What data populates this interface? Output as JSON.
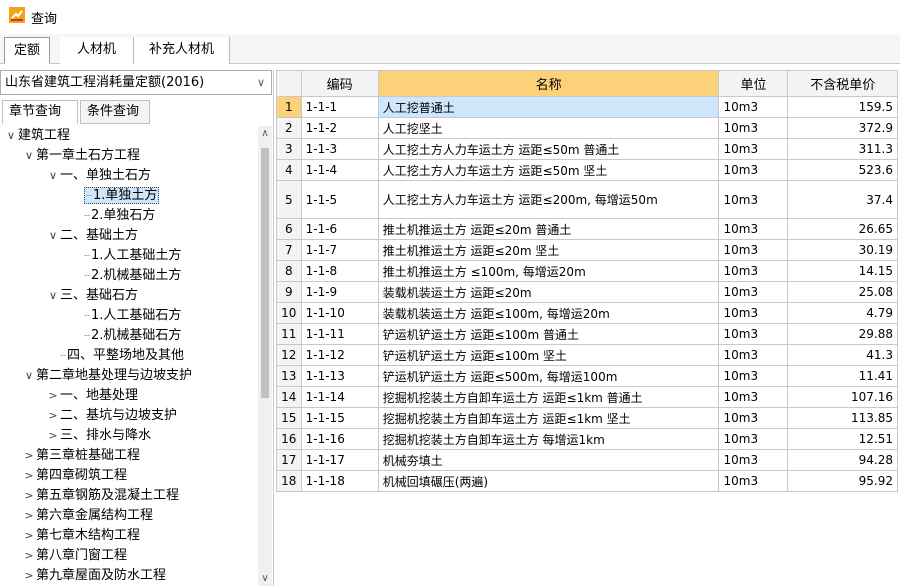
{
  "window": {
    "title": "查询"
  },
  "tabs": [
    "定额",
    "人材机",
    "补充人材机"
  ],
  "left": {
    "quota_select": "山东省建筑工程消耗量定额(2016)",
    "query_tabs": [
      "章节查询",
      "条件查询"
    ],
    "tree": [
      {
        "label": "建筑工程",
        "level": 0,
        "toggle": "∨"
      },
      {
        "label": "第一章土石方工程",
        "level": 1,
        "toggle": "∨"
      },
      {
        "label": "一、单独土石方",
        "level": 2,
        "toggle": "∨"
      },
      {
        "label": "1.单独土方",
        "level": 3,
        "toggle": "",
        "selected": true
      },
      {
        "label": "2.单独石方",
        "level": 3,
        "toggle": ""
      },
      {
        "label": "二、基础土方",
        "level": 2,
        "toggle": "∨"
      },
      {
        "label": "1.人工基础土方",
        "level": 3,
        "toggle": ""
      },
      {
        "label": "2.机械基础土方",
        "level": 3,
        "toggle": ""
      },
      {
        "label": "三、基础石方",
        "level": 2,
        "toggle": "∨"
      },
      {
        "label": "1.人工基础石方",
        "level": 3,
        "toggle": ""
      },
      {
        "label": "2.机械基础石方",
        "level": 3,
        "toggle": ""
      },
      {
        "label": "四、平整场地及其他",
        "level": 2,
        "toggle": ""
      },
      {
        "label": "第二章地基处理与边坡支护",
        "level": 1,
        "toggle": "∨"
      },
      {
        "label": "一、地基处理",
        "level": 2,
        "toggle": ">"
      },
      {
        "label": "二、基坑与边坡支护",
        "level": 2,
        "toggle": ">"
      },
      {
        "label": "三、排水与降水",
        "level": 2,
        "toggle": ">"
      },
      {
        "label": "第三章桩基础工程",
        "level": 1,
        "toggle": ">"
      },
      {
        "label": "第四章砌筑工程",
        "level": 1,
        "toggle": ">"
      },
      {
        "label": "第五章钢筋及混凝土工程",
        "level": 1,
        "toggle": ">"
      },
      {
        "label": "第六章金属结构工程",
        "level": 1,
        "toggle": ">"
      },
      {
        "label": "第七章木结构工程",
        "level": 1,
        "toggle": ">"
      },
      {
        "label": "第八章门窗工程",
        "level": 1,
        "toggle": ">"
      },
      {
        "label": "第九章屋面及防水工程",
        "level": 1,
        "toggle": ">"
      }
    ]
  },
  "grid": {
    "headers": [
      "",
      "编码",
      "名称",
      "单位",
      "不含税单价"
    ],
    "rows": [
      [
        "1",
        "1-1-1",
        "人工挖普通土",
        "10m3",
        "159.5"
      ],
      [
        "2",
        "1-1-2",
        "人工挖坚土",
        "10m3",
        "372.9"
      ],
      [
        "3",
        "1-1-3",
        "人工挖土方人力车运土方 运距≤50m 普通土",
        "10m3",
        "311.3"
      ],
      [
        "4",
        "1-1-4",
        "人工挖土方人力车运土方 运距≤50m 坚土",
        "10m3",
        "523.6"
      ],
      [
        "5",
        "1-1-5",
        "人工挖土方人力车运土方 运距≤200m, 每增运50m",
        "10m3",
        "37.4"
      ],
      [
        "6",
        "1-1-6",
        "推土机推运土方 运距≤20m 普通土",
        "10m3",
        "26.65"
      ],
      [
        "7",
        "1-1-7",
        "推土机推运土方 运距≤20m 坚土",
        "10m3",
        "30.19"
      ],
      [
        "8",
        "1-1-8",
        "推土机推运土方 ≤100m, 每增运20m",
        "10m3",
        "14.15"
      ],
      [
        "9",
        "1-1-9",
        "装载机装运土方 运距≤20m",
        "10m3",
        "25.08"
      ],
      [
        "10",
        "1-1-10",
        "装载机装运土方 运距≤100m, 每增运20m",
        "10m3",
        "4.79"
      ],
      [
        "11",
        "1-1-11",
        "铲运机铲运土方 运距≤100m 普通土",
        "10m3",
        "29.88"
      ],
      [
        "12",
        "1-1-12",
        "铲运机铲运土方 运距≤100m 坚土",
        "10m3",
        "41.3"
      ],
      [
        "13",
        "1-1-13",
        "铲运机铲运土方 运距≤500m, 每增运100m",
        "10m3",
        "11.41"
      ],
      [
        "14",
        "1-1-14",
        "挖掘机挖装土方自卸车运土方 运距≤1km 普通土",
        "10m3",
        "107.16"
      ],
      [
        "15",
        "1-1-15",
        "挖掘机挖装土方自卸车运土方 运距≤1km 坚土",
        "10m3",
        "113.85"
      ],
      [
        "16",
        "1-1-16",
        "挖掘机挖装土方自卸车运土方 每增运1km",
        "10m3",
        "12.51"
      ],
      [
        "17",
        "1-1-17",
        "机械夯填土",
        "10m3",
        "94.28"
      ],
      [
        "18",
        "1-1-18",
        "机械回填碾压(两遍)",
        "10m3",
        "95.92"
      ]
    ]
  }
}
